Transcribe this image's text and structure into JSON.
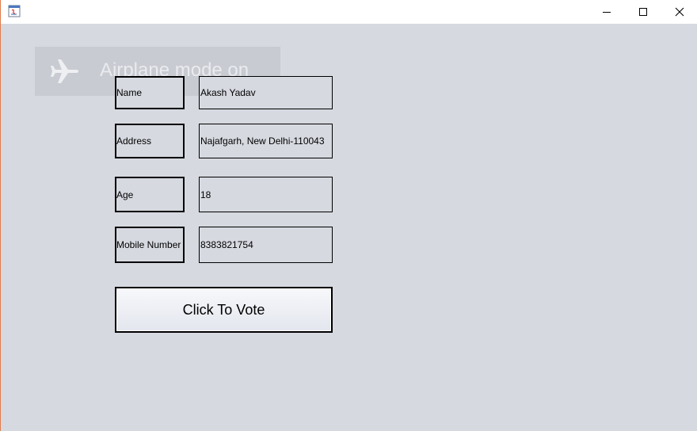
{
  "titlebar": {
    "icons": {
      "app": "java-app-icon",
      "minimize": "minimize-icon",
      "maximize": "maximize-icon",
      "close": "close-icon"
    }
  },
  "toast": {
    "icon": "airplane-icon",
    "text": "Airplane mode on"
  },
  "form": {
    "fields": [
      {
        "label": "Name",
        "value": "Akash Yadav"
      },
      {
        "label": "Address",
        "value": "Najafgarh, New Delhi-110043"
      },
      {
        "label": "Age",
        "value": "18"
      },
      {
        "label": "Mobile Number",
        "value": "8383821754"
      }
    ],
    "submit_label": "Click To Vote"
  },
  "colors": {
    "background": "#d6d9e0",
    "titlebar": "#ffffff",
    "window_edge": "#e07b4a"
  }
}
